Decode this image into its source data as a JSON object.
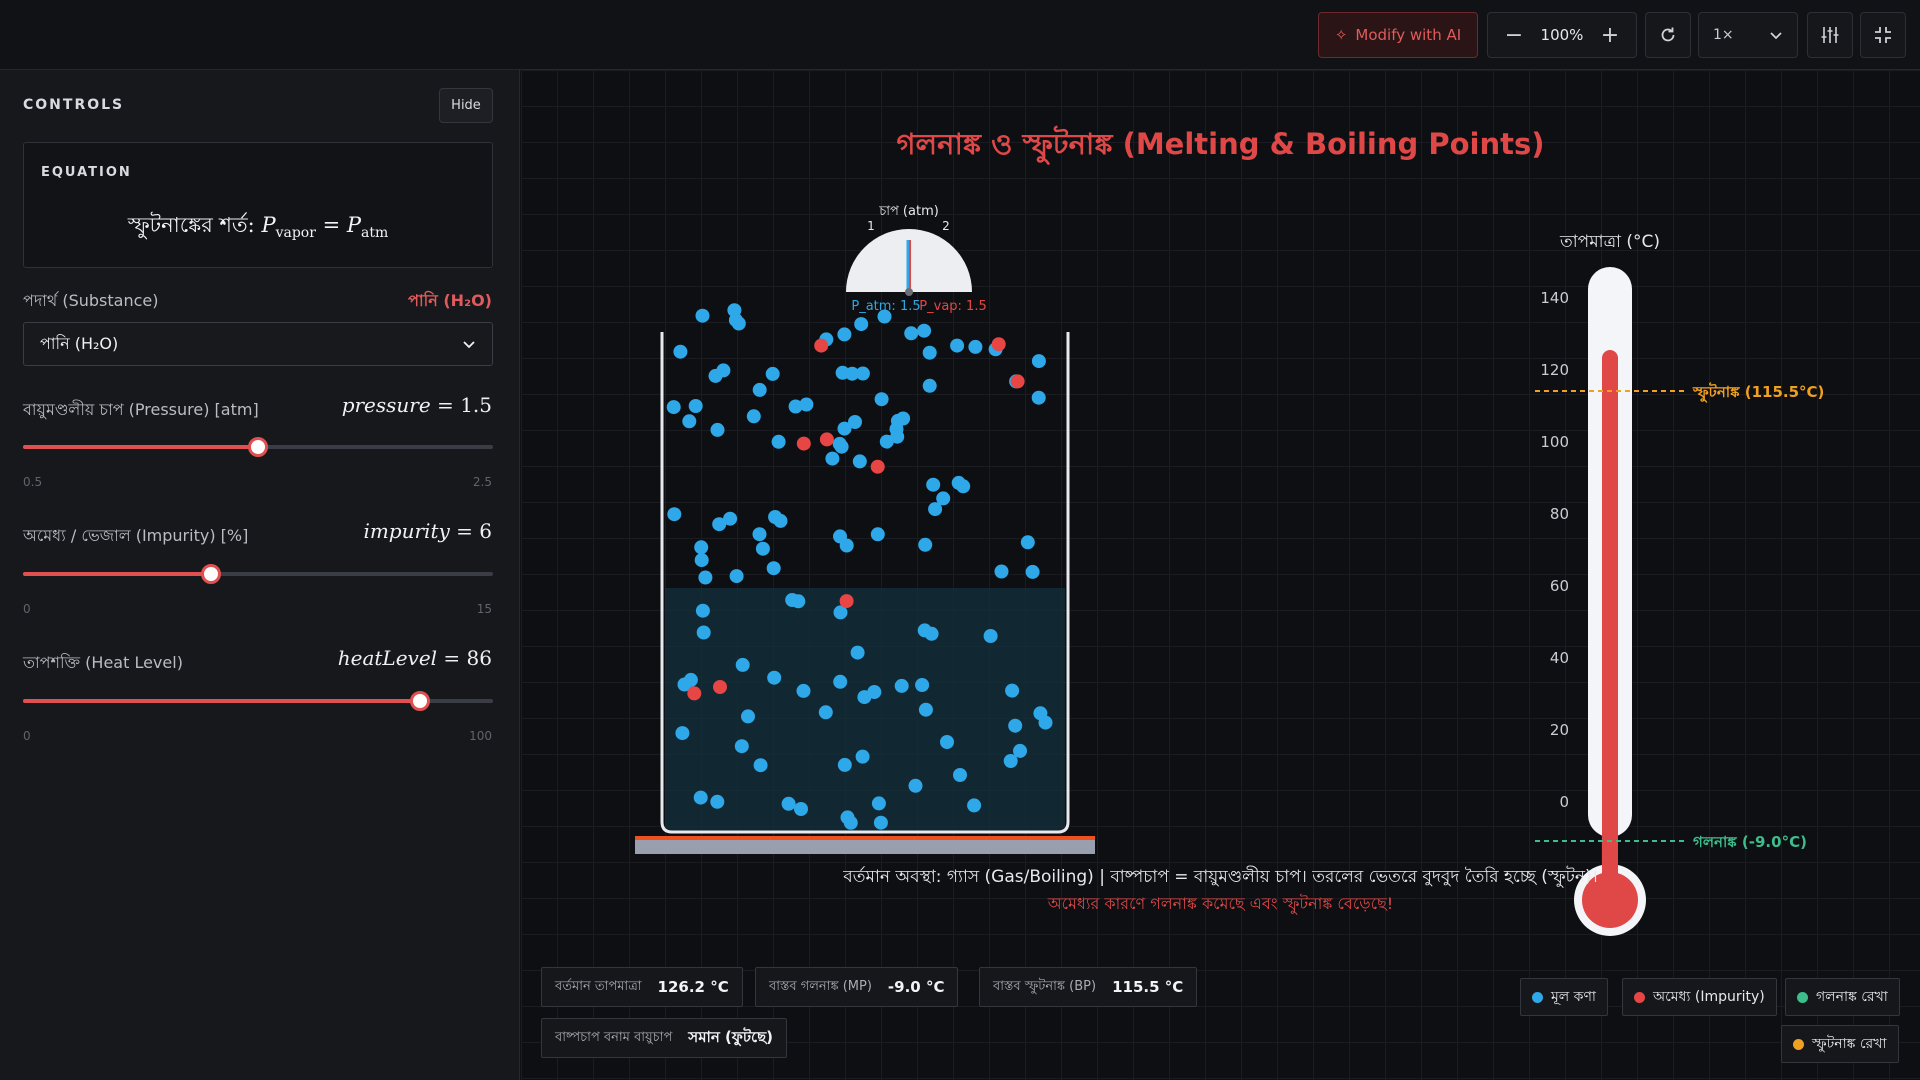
{
  "toolbar": {
    "ai_label": "Modify with AI",
    "zoom_out": "−",
    "zoom_value": "100%",
    "zoom_in": "+",
    "speed_value": "1×",
    "icons": [
      "sparkle-icon",
      "reset-icon",
      "chevron-down-icon",
      "sliders-icon",
      "fullscreen-exit-icon"
    ]
  },
  "controls": {
    "title": "CONTROLS",
    "hide_label": "Hide",
    "equation": {
      "title": "EQUATION",
      "prefix": "স্ফুটনাঙ্কের শর্ত:",
      "lhs": "P",
      "lhs_sub": "vapor",
      "rhs": "P",
      "rhs_sub": "atm"
    },
    "substance": {
      "label": "পদার্থ (Substance)",
      "value_display": "পানি (H₂O)",
      "selected": "পানি (H₂O)"
    },
    "sliders": [
      {
        "label": "বায়ুমণ্ডলীয় চাপ (Pressure) [atm]",
        "var": "pressure",
        "value": "1.5",
        "min": "0.5",
        "max": "2.5",
        "fraction": 0.5
      },
      {
        "label": "অমেধ্য / ভেজাল (Impurity) [%]",
        "var": "impurity",
        "value": "6",
        "min": "0",
        "max": "15",
        "fraction": 0.4
      },
      {
        "label": "তাপশক্তি (Heat Level)",
        "var": "heatLevel",
        "value": "86",
        "min": "0",
        "max": "100",
        "fraction": 0.845
      }
    ]
  },
  "sim": {
    "title": "গলনাঙ্ক ও স্ফুটনাঙ্ক (Melting & Boiling Points)",
    "gauge": {
      "title": "চাপ (atm)",
      "tick1": "1",
      "tick2": "2",
      "p_atm": "P_atm: 1.5",
      "p_vap": "P_vap: 1.5"
    },
    "thermometer": {
      "title": "তাপমাত্রা (°C)",
      "ticks": [
        "140",
        "120",
        "100",
        "80",
        "60",
        "40",
        "20",
        "0"
      ],
      "bp_label": "স্ফুটনাঙ্ক (115.5°C)",
      "mp_label": "গলনাঙ্ক (-9.0°C)",
      "temperature": 126.2
    },
    "status_line": "বর্তমান অবস্থা: গ্যাস (Gas/Boiling) | বাষ্পচাপ = বায়ুমণ্ডলীয় চাপ। তরলের ভেতরে বুদবুদ তৈরি হচ্ছে (স্ফুটন)।",
    "impurity_note": "অমেধ্যর কারণে গলনাঙ্ক কমেছে এবং স্ফুটনাঙ্ক বেড়েছে!",
    "info": [
      {
        "label": "বর্তমান তাপমাত্রা",
        "value": "126.2 °C"
      },
      {
        "label": "বাস্তব গলনাঙ্ক (MP)",
        "value": "-9.0 °C"
      },
      {
        "label": "বাস্তব স্ফুটনাঙ্ক (BP)",
        "value": "115.5 °C"
      },
      {
        "label": "বাষ্পচাপ বনাম বায়ুচাপ",
        "value": "সমান (ফুটছে)"
      }
    ],
    "legend": [
      {
        "label": "মূল কণা",
        "color": "#2ea8e8"
      },
      {
        "label": "অমেধ্য (Impurity)",
        "color": "#e84545"
      },
      {
        "label": "গলনাঙ্ক রেখা",
        "color": "#3ebc8c"
      },
      {
        "label": "স্ফুটনাঙ্ক রেখা",
        "color": "#f0a020"
      }
    ],
    "colors": {
      "accent": "#e04848",
      "particle": "#2ea8e8",
      "impurity": "#e84545",
      "mp_line": "#3ebc8c",
      "bp_line": "#f0a020"
    }
  }
}
